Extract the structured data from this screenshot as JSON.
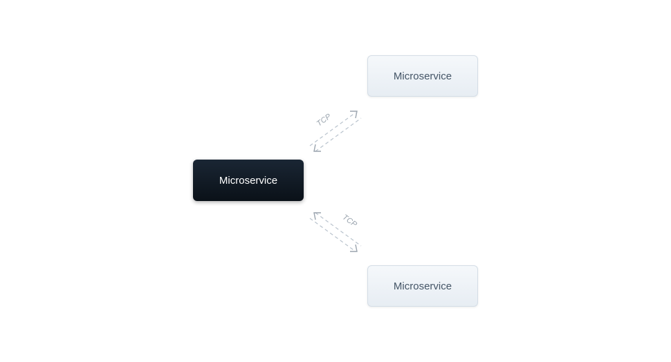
{
  "nodes": {
    "main": {
      "label": "Microservice"
    },
    "top": {
      "label": "Microservice"
    },
    "bottom": {
      "label": "Microservice"
    }
  },
  "connections": {
    "top": {
      "label": "TCP"
    },
    "bottom": {
      "label": "TCP"
    }
  }
}
